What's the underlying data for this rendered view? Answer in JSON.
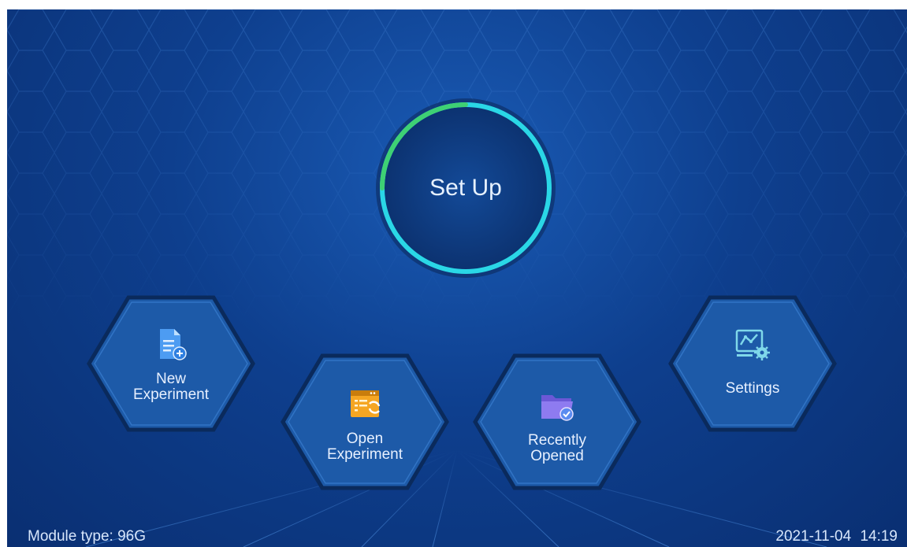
{
  "center_button": {
    "label": "Set Up"
  },
  "tiles": [
    {
      "line1": "New",
      "line2": "Experiment",
      "icon": "new-document-icon"
    },
    {
      "line1": "Open",
      "line2": "Experiment",
      "icon": "open-window-refresh-icon"
    },
    {
      "line1": "Recently",
      "line2": "Opened",
      "icon": "folder-check-icon"
    },
    {
      "line1": "Settings",
      "line2": "",
      "icon": "chart-gear-icon"
    }
  ],
  "footer": {
    "module_type": "Module type: 96G",
    "datetime": "2021-11-04 14:19"
  },
  "colors": {
    "ring_cyan": "#2ad7e6",
    "ring_green": "#3ed174",
    "icon_orange": "#f5a623",
    "icon_purple": "#8e7bf0",
    "icon_blue": "#4d9cf2"
  }
}
